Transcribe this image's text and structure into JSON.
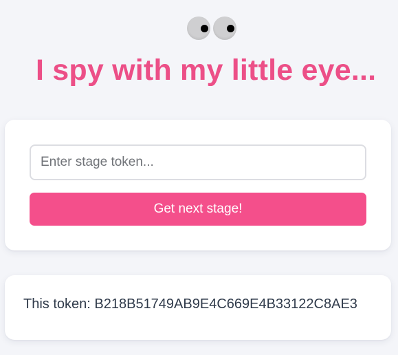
{
  "header": {
    "eyes_icon": "googly-eyes",
    "title": "I spy with my little eye..."
  },
  "form": {
    "token_placeholder": "Enter stage token...",
    "token_value": "",
    "submit_label": "Get next stage!"
  },
  "token_card": {
    "label": "This token:",
    "value": "B218B51749AB9E4C669E4B33122C8AE3"
  },
  "colors": {
    "accent": "#f44f8b",
    "title": "#ec4f87",
    "background": "#f4f5f9"
  }
}
